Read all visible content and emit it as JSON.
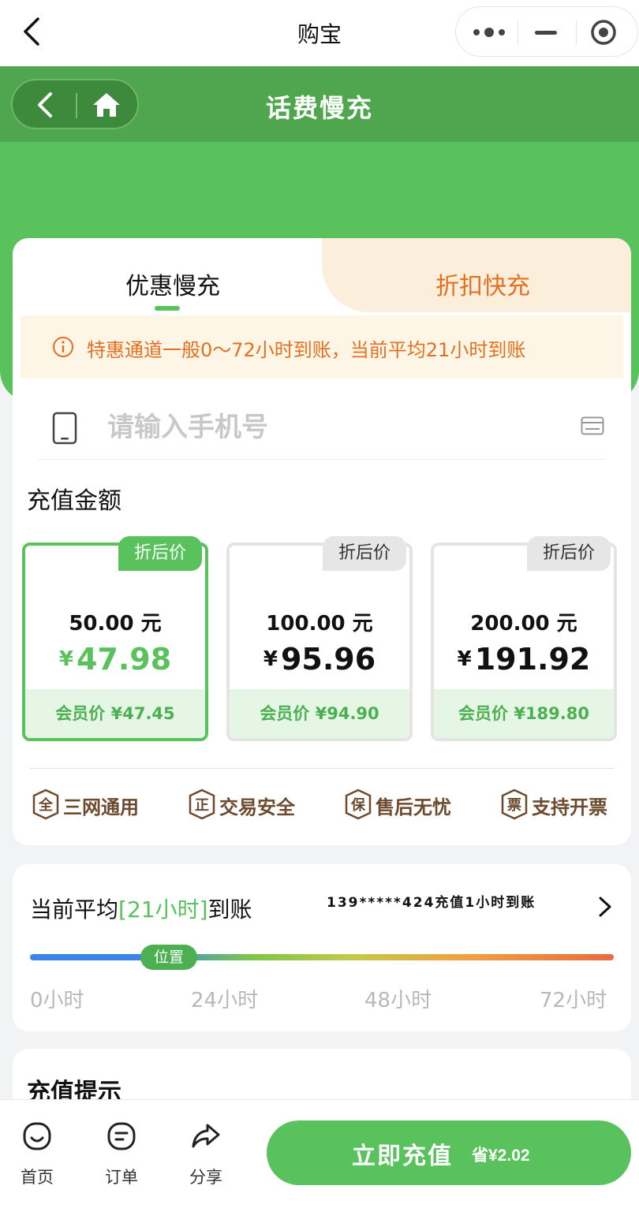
{
  "topbar": {
    "title": "购宝"
  },
  "header": {
    "title": "话费慢充"
  },
  "tabs": [
    {
      "label": "优惠慢充",
      "active": true
    },
    {
      "label": "折扣快充",
      "active": false
    }
  ],
  "notice": {
    "text": "特惠通道一般0～72小时到账，当前平均21小时到账"
  },
  "phone": {
    "placeholder": "请输入手机号",
    "value": ""
  },
  "amount": {
    "title": "充值金额",
    "options": [
      {
        "badge": "折后价",
        "face": "50.00 元",
        "currency": "¥",
        "price": "47.98",
        "member": "会员价 ¥47.45",
        "selected": true
      },
      {
        "badge": "折后价",
        "face": "100.00 元",
        "currency": "¥",
        "price": "95.96",
        "member": "会员价 ¥94.90",
        "selected": false
      },
      {
        "badge": "折后价",
        "face": "200.00 元",
        "currency": "¥",
        "price": "191.92",
        "member": "会员价 ¥189.80",
        "selected": false
      }
    ]
  },
  "guarantees": [
    {
      "icon": "全",
      "label": "三网通用"
    },
    {
      "icon": "正",
      "label": "交易安全"
    },
    {
      "icon": "保",
      "label": "售后无忧"
    },
    {
      "icon": "票",
      "label": "支持开票"
    }
  ],
  "timing": {
    "avg_prefix": "当前平均",
    "avg_value": "[21小时]",
    "avg_suffix": "到账",
    "recent": "139*****424充值1小时到账",
    "marker": "位置",
    "ticks": [
      "0小时",
      "24小时",
      "48小时",
      "72小时"
    ]
  },
  "tips": {
    "title": "充值提示"
  },
  "bottom": {
    "nav": [
      {
        "label": "首页",
        "icon": "home-face-icon"
      },
      {
        "label": "订单",
        "icon": "order-icon"
      },
      {
        "label": "分享",
        "icon": "share-icon"
      }
    ],
    "charge_label": "立即充值",
    "save_label": "省¥2.02"
  },
  "colors": {
    "primary": "#59c25d",
    "primary_dark": "#4fa64f",
    "accent_orange": "#e36f20",
    "guarantee_brown": "#6b4a2e"
  }
}
